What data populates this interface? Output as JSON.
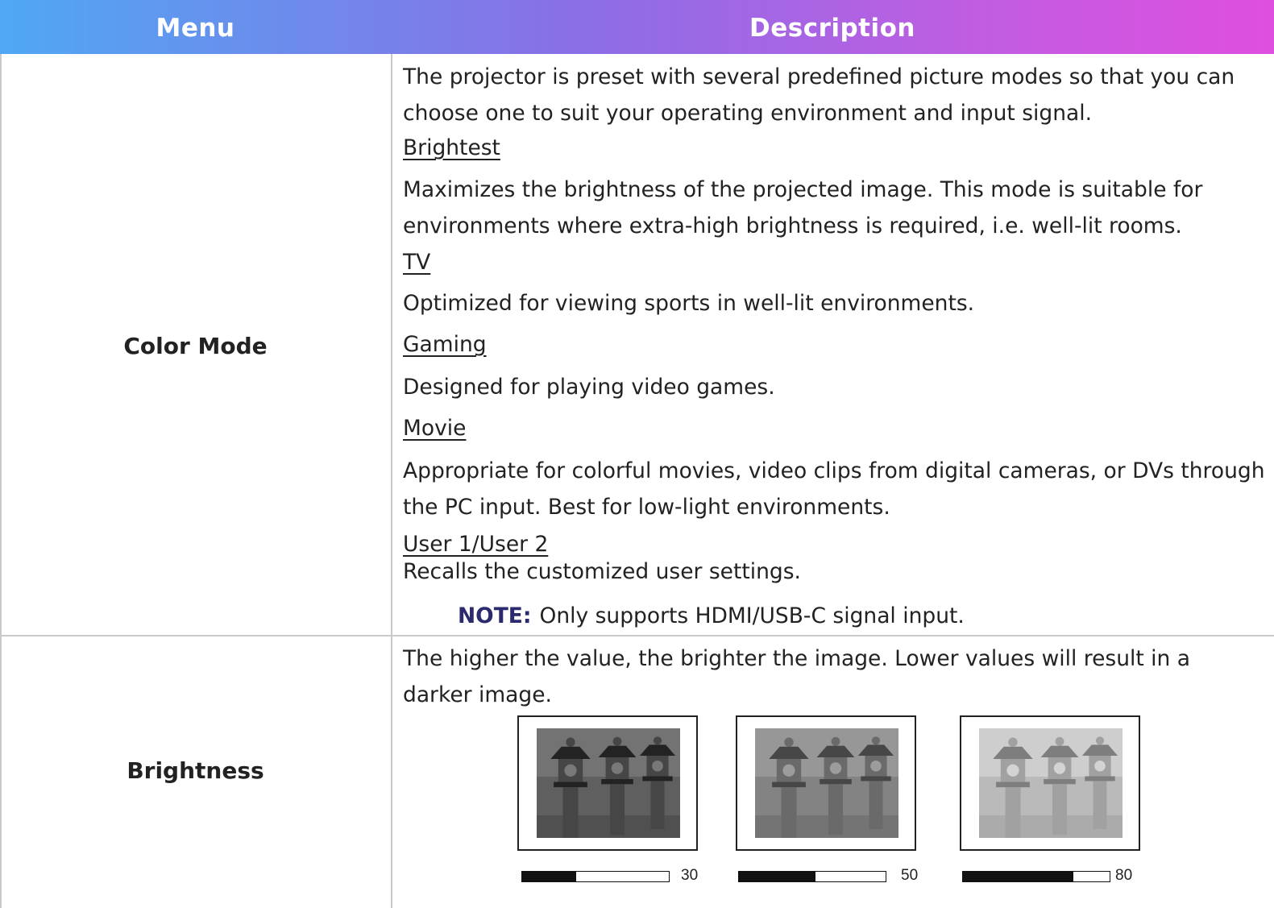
{
  "header": {
    "menu": "Menu",
    "description": "Description"
  },
  "color_mode": {
    "label": "Color Mode",
    "intro": "The projector is preset with several predefined picture modes so that you can choose one to suit your operating environment and input signal.",
    "modes": [
      {
        "name": "Brightest",
        "desc": "Maximizes the brightness of the projected image. This mode is suitable for environments where extra-high brightness is required, i.e. well-lit rooms."
      },
      {
        "name": "TV",
        "desc": "Optimized for viewing sports in well-lit environments."
      },
      {
        "name": "Gaming",
        "desc": "Designed for playing video games."
      },
      {
        "name": "Movie",
        "desc": "Appropriate for colorful movies, video clips from digital cameras, or DVs through the PC input. Best for low-light environments."
      },
      {
        "name": "User 1/User 2",
        "desc": "Recalls the customized user settings."
      }
    ],
    "note_label": "NOTE:",
    "note_text": "Only supports HDMI/USB-C signal input."
  },
  "brightness": {
    "label": "Brightness",
    "desc": "The higher the value, the brighter the image. Lower values will result in a darker image.",
    "samples": [
      {
        "value": "30",
        "level": 0.37
      },
      {
        "value": "50",
        "level": 0.52
      },
      {
        "value": "80",
        "level": 0.75
      }
    ]
  },
  "colors": {
    "header_gradient": [
      "#4fa8f2",
      "#8a6fe6",
      "#c55be0",
      "#df4fdf"
    ],
    "grid_line": "#c9c9c9",
    "note_label": "#2b2a6e"
  }
}
